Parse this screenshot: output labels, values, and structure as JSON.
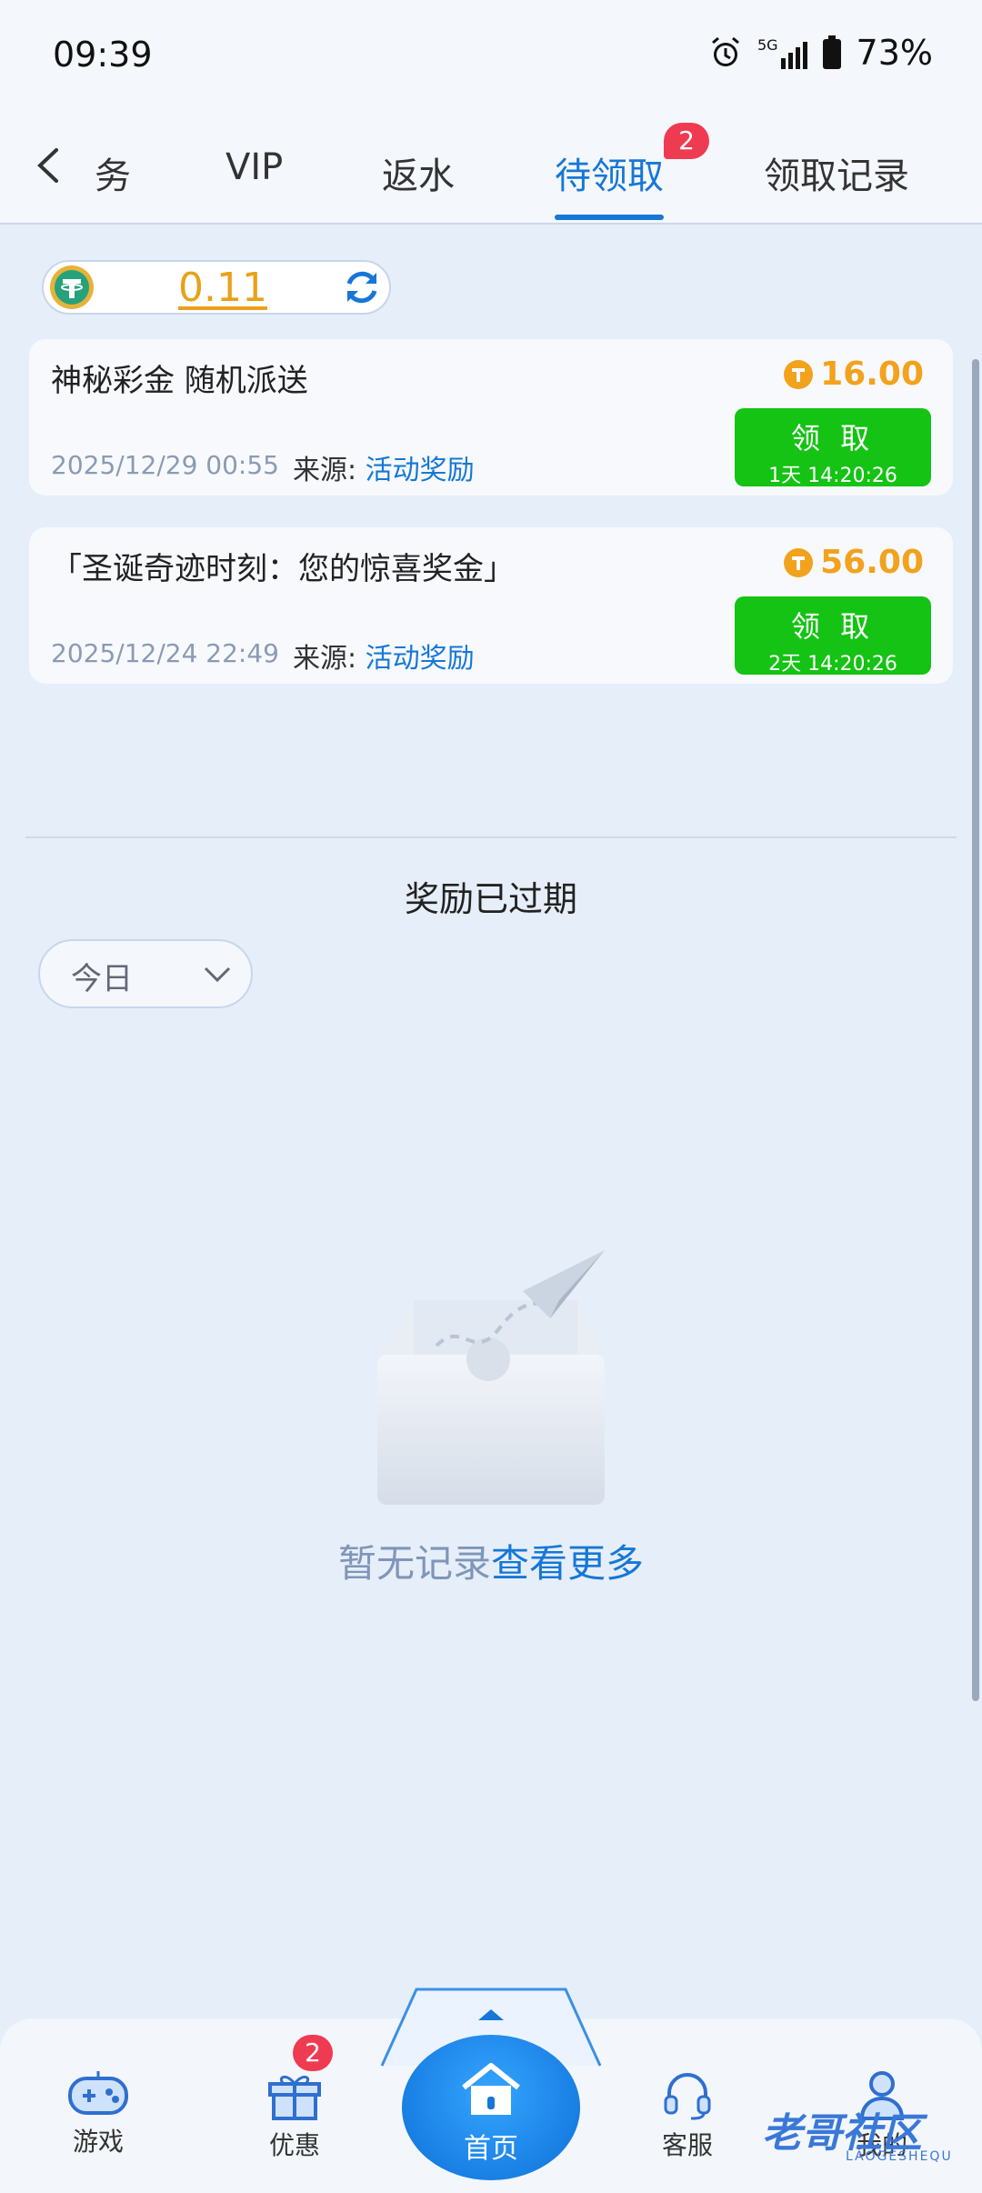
{
  "status_bar": {
    "time": "09:39",
    "network": "5G",
    "battery": "73%"
  },
  "tabs": [
    {
      "label": "务"
    },
    {
      "label": "VIP"
    },
    {
      "label": "返水"
    },
    {
      "label": "待领取",
      "badge": "2"
    },
    {
      "label": "领取记录"
    }
  ],
  "balance": {
    "value": "0.11"
  },
  "rewards": [
    {
      "title": "神秘彩金  随机派送",
      "amount": "16.00",
      "date": "2025/12/29 00:55",
      "source_label": "来源:",
      "source_value": "活动奖励",
      "button_label": "领 取",
      "timer": "1天 14:20:26"
    },
    {
      "title": "「圣诞奇迹时刻：您的惊喜奖金」",
      "amount": "56.00",
      "date": "2025/12/24 22:49",
      "source_label": "来源:",
      "source_value": "活动奖励",
      "button_label": "领 取",
      "timer": "2天 14:20:26"
    }
  ],
  "expired": {
    "title": "奖励已过期",
    "filter": "今日",
    "empty_text": "暂无记录",
    "view_more": "查看更多"
  },
  "bottom_nav": {
    "games": "游戏",
    "promos": "优惠",
    "promos_badge": "2",
    "home": "首页",
    "support": "客服",
    "mine": "我的"
  },
  "watermark": {
    "text": "老哥社区",
    "sub": "LAOGESHEQU"
  },
  "colors": {
    "accent": "#1677d6",
    "claim": "#14c314",
    "amount": "#f2a21c",
    "badge": "#ef3b52"
  }
}
